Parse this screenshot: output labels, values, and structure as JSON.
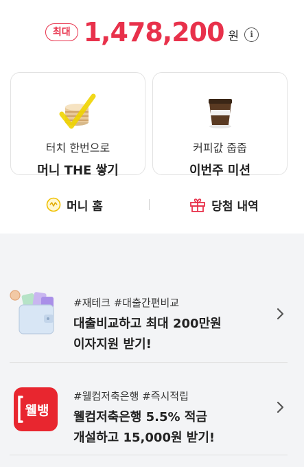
{
  "summary": {
    "max_badge": "최대",
    "amount": "1,478,200",
    "currency": "원"
  },
  "cards": [
    {
      "subtitle": "터치 한번으로",
      "title": "머니 THE 쌓기",
      "icon": "coin-stack-icon"
    },
    {
      "subtitle": "커피값 줍줍",
      "title": "이번주 미션",
      "icon": "coffee-cup-icon"
    }
  ],
  "links": [
    {
      "label": "머니 홈",
      "icon": "money-coin-icon"
    },
    {
      "label": "당첨 내역",
      "icon": "gift-icon"
    }
  ],
  "promos": [
    {
      "tags": "#재테크 #대출간편비교",
      "line1": "대출비교하고 최대 200만원",
      "line2": "이자지원 받기!",
      "icon": "wallet-icon"
    },
    {
      "tags": "#웰컴저축은행 #즉시적립",
      "line1": "웰컴저축은행 5.5% 적금",
      "line2": "개설하고 15,000원 받기!",
      "icon": "welcome-bank-logo",
      "logo_text": "웰뱅"
    }
  ],
  "colors": {
    "accent": "#e8314b",
    "highlight": "#f0d400",
    "background_lower": "#f3f4f6"
  }
}
